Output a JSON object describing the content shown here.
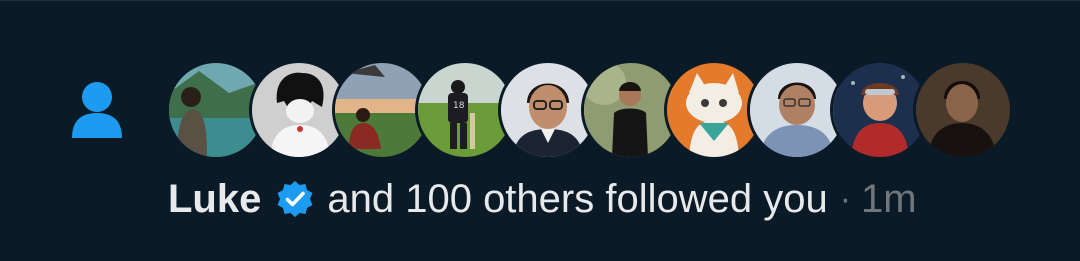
{
  "notification": {
    "icon": "person-icon",
    "accent_color": "#1d9bf0",
    "avatars": [
      {
        "name": "avatar-lake-person",
        "bg": "#4b8a8e"
      },
      {
        "name": "avatar-anime-sketch",
        "bg": "#c8c8c8"
      },
      {
        "name": "avatar-sunset-field",
        "bg": "#6a7b88"
      },
      {
        "name": "avatar-cricket-player",
        "bg": "#5a8a3c"
      },
      {
        "name": "avatar-man-glasses",
        "bg": "#d9dde2"
      },
      {
        "name": "avatar-man-outdoor",
        "bg": "#8e9a6a"
      },
      {
        "name": "avatar-cat-cartoon",
        "bg": "#e0782e"
      },
      {
        "name": "avatar-man-checked-shirt",
        "bg": "#c9d3de"
      },
      {
        "name": "avatar-cartoon-kid",
        "bg": "#1f3350"
      },
      {
        "name": "avatar-man-dark",
        "bg": "#3a2e24"
      }
    ],
    "user_name": "Luke",
    "verified_icon": "verified-badge-icon",
    "action_text": "and 100 others followed you",
    "separator": "·",
    "time": "1m"
  }
}
